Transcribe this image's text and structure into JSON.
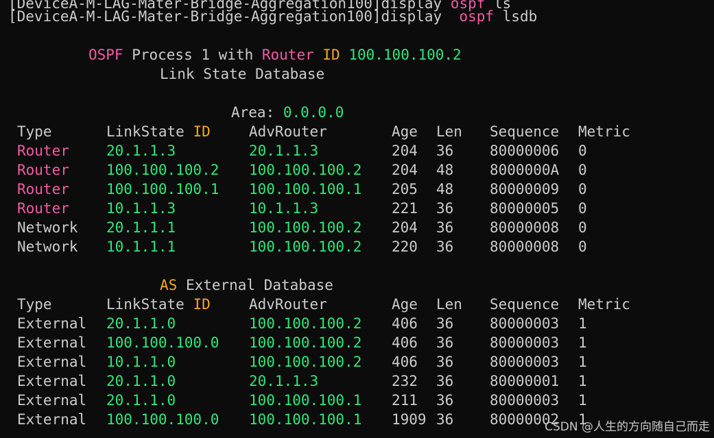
{
  "cmd_prev": {
    "prefix": "[DeviceA-M-LAG-Mater-Bridge-Aggregation100]display ",
    "kw": "ospf",
    "rest": " ls"
  },
  "cmd": {
    "prefix": "[DeviceA-M-LAG-Mater-Bridge-Aggregation100]display  ",
    "kw": "ospf",
    "rest": " lsdb"
  },
  "header": {
    "ospf": "OSPF",
    "process": " Process 1 with ",
    "router": "Router",
    "id": "ID",
    "router_id": "100.100.100.2",
    "lsdb_title": "Link State Database",
    "area_label": "Area: ",
    "area_value": "0.0.0.0"
  },
  "columns": {
    "type": "Type",
    "linkstate": "LinkState ",
    "id": "ID",
    "advrouter": "AdvRouter",
    "age": "Age",
    "len": "Len",
    "sequence": "Sequence",
    "metric": "Metric"
  },
  "area_rows": [
    {
      "type": "Router",
      "lsid": "20.1.1.3",
      "adv": "20.1.1.3",
      "age": "204",
      "len": "36",
      "seq": "80000006",
      "metric": "0"
    },
    {
      "type": "Router",
      "lsid": "100.100.100.2",
      "adv": "100.100.100.2",
      "age": "204",
      "len": "48",
      "seq": "8000000A",
      "metric": "0"
    },
    {
      "type": "Router",
      "lsid": "100.100.100.1",
      "adv": "100.100.100.1",
      "age": "205",
      "len": "48",
      "seq": "80000009",
      "metric": "0"
    },
    {
      "type": "Router",
      "lsid": "10.1.1.3",
      "adv": "10.1.1.3",
      "age": "221",
      "len": "36",
      "seq": "80000005",
      "metric": "0"
    },
    {
      "type": "Network",
      "lsid": "20.1.1.1",
      "adv": "100.100.100.2",
      "age": "204",
      "len": "36",
      "seq": "80000008",
      "metric": "0"
    },
    {
      "type": "Network",
      "lsid": "10.1.1.1",
      "adv": "100.100.100.2",
      "age": "220",
      "len": "36",
      "seq": "80000008",
      "metric": "0"
    }
  ],
  "ext_header": {
    "as": "AS",
    "rest": " External Database"
  },
  "ext_rows": [
    {
      "type": "External",
      "lsid": "20.1.1.0",
      "adv": "100.100.100.2",
      "age": "406",
      "len": "36",
      "seq": "80000003",
      "metric": "1"
    },
    {
      "type": "External",
      "lsid": "100.100.100.0",
      "adv": "100.100.100.2",
      "age": "406",
      "len": "36",
      "seq": "80000003",
      "metric": "1"
    },
    {
      "type": "External",
      "lsid": "10.1.1.0",
      "adv": "100.100.100.2",
      "age": "406",
      "len": "36",
      "seq": "80000003",
      "metric": "1"
    },
    {
      "type": "External",
      "lsid": "20.1.1.0",
      "adv": "20.1.1.3",
      "age": "232",
      "len": "36",
      "seq": "80000001",
      "metric": "1"
    },
    {
      "type": "External",
      "lsid": "20.1.1.0",
      "adv": "100.100.100.1",
      "age": "211",
      "len": "36",
      "seq": "80000003",
      "metric": "1"
    },
    {
      "type": "External",
      "lsid": "100.100.100.0",
      "adv": "100.100.100.1",
      "age": "1909",
      "len": "36",
      "seq": "80000002",
      "metric": "1"
    }
  ],
  "watermark": "CSDN @人生的方向随自己而走",
  "colors": {
    "background": "#0c0c0c",
    "keyword": "#f25aa6",
    "id": "#f5a623",
    "value": "#2ee87b",
    "text": "#cccccc"
  }
}
